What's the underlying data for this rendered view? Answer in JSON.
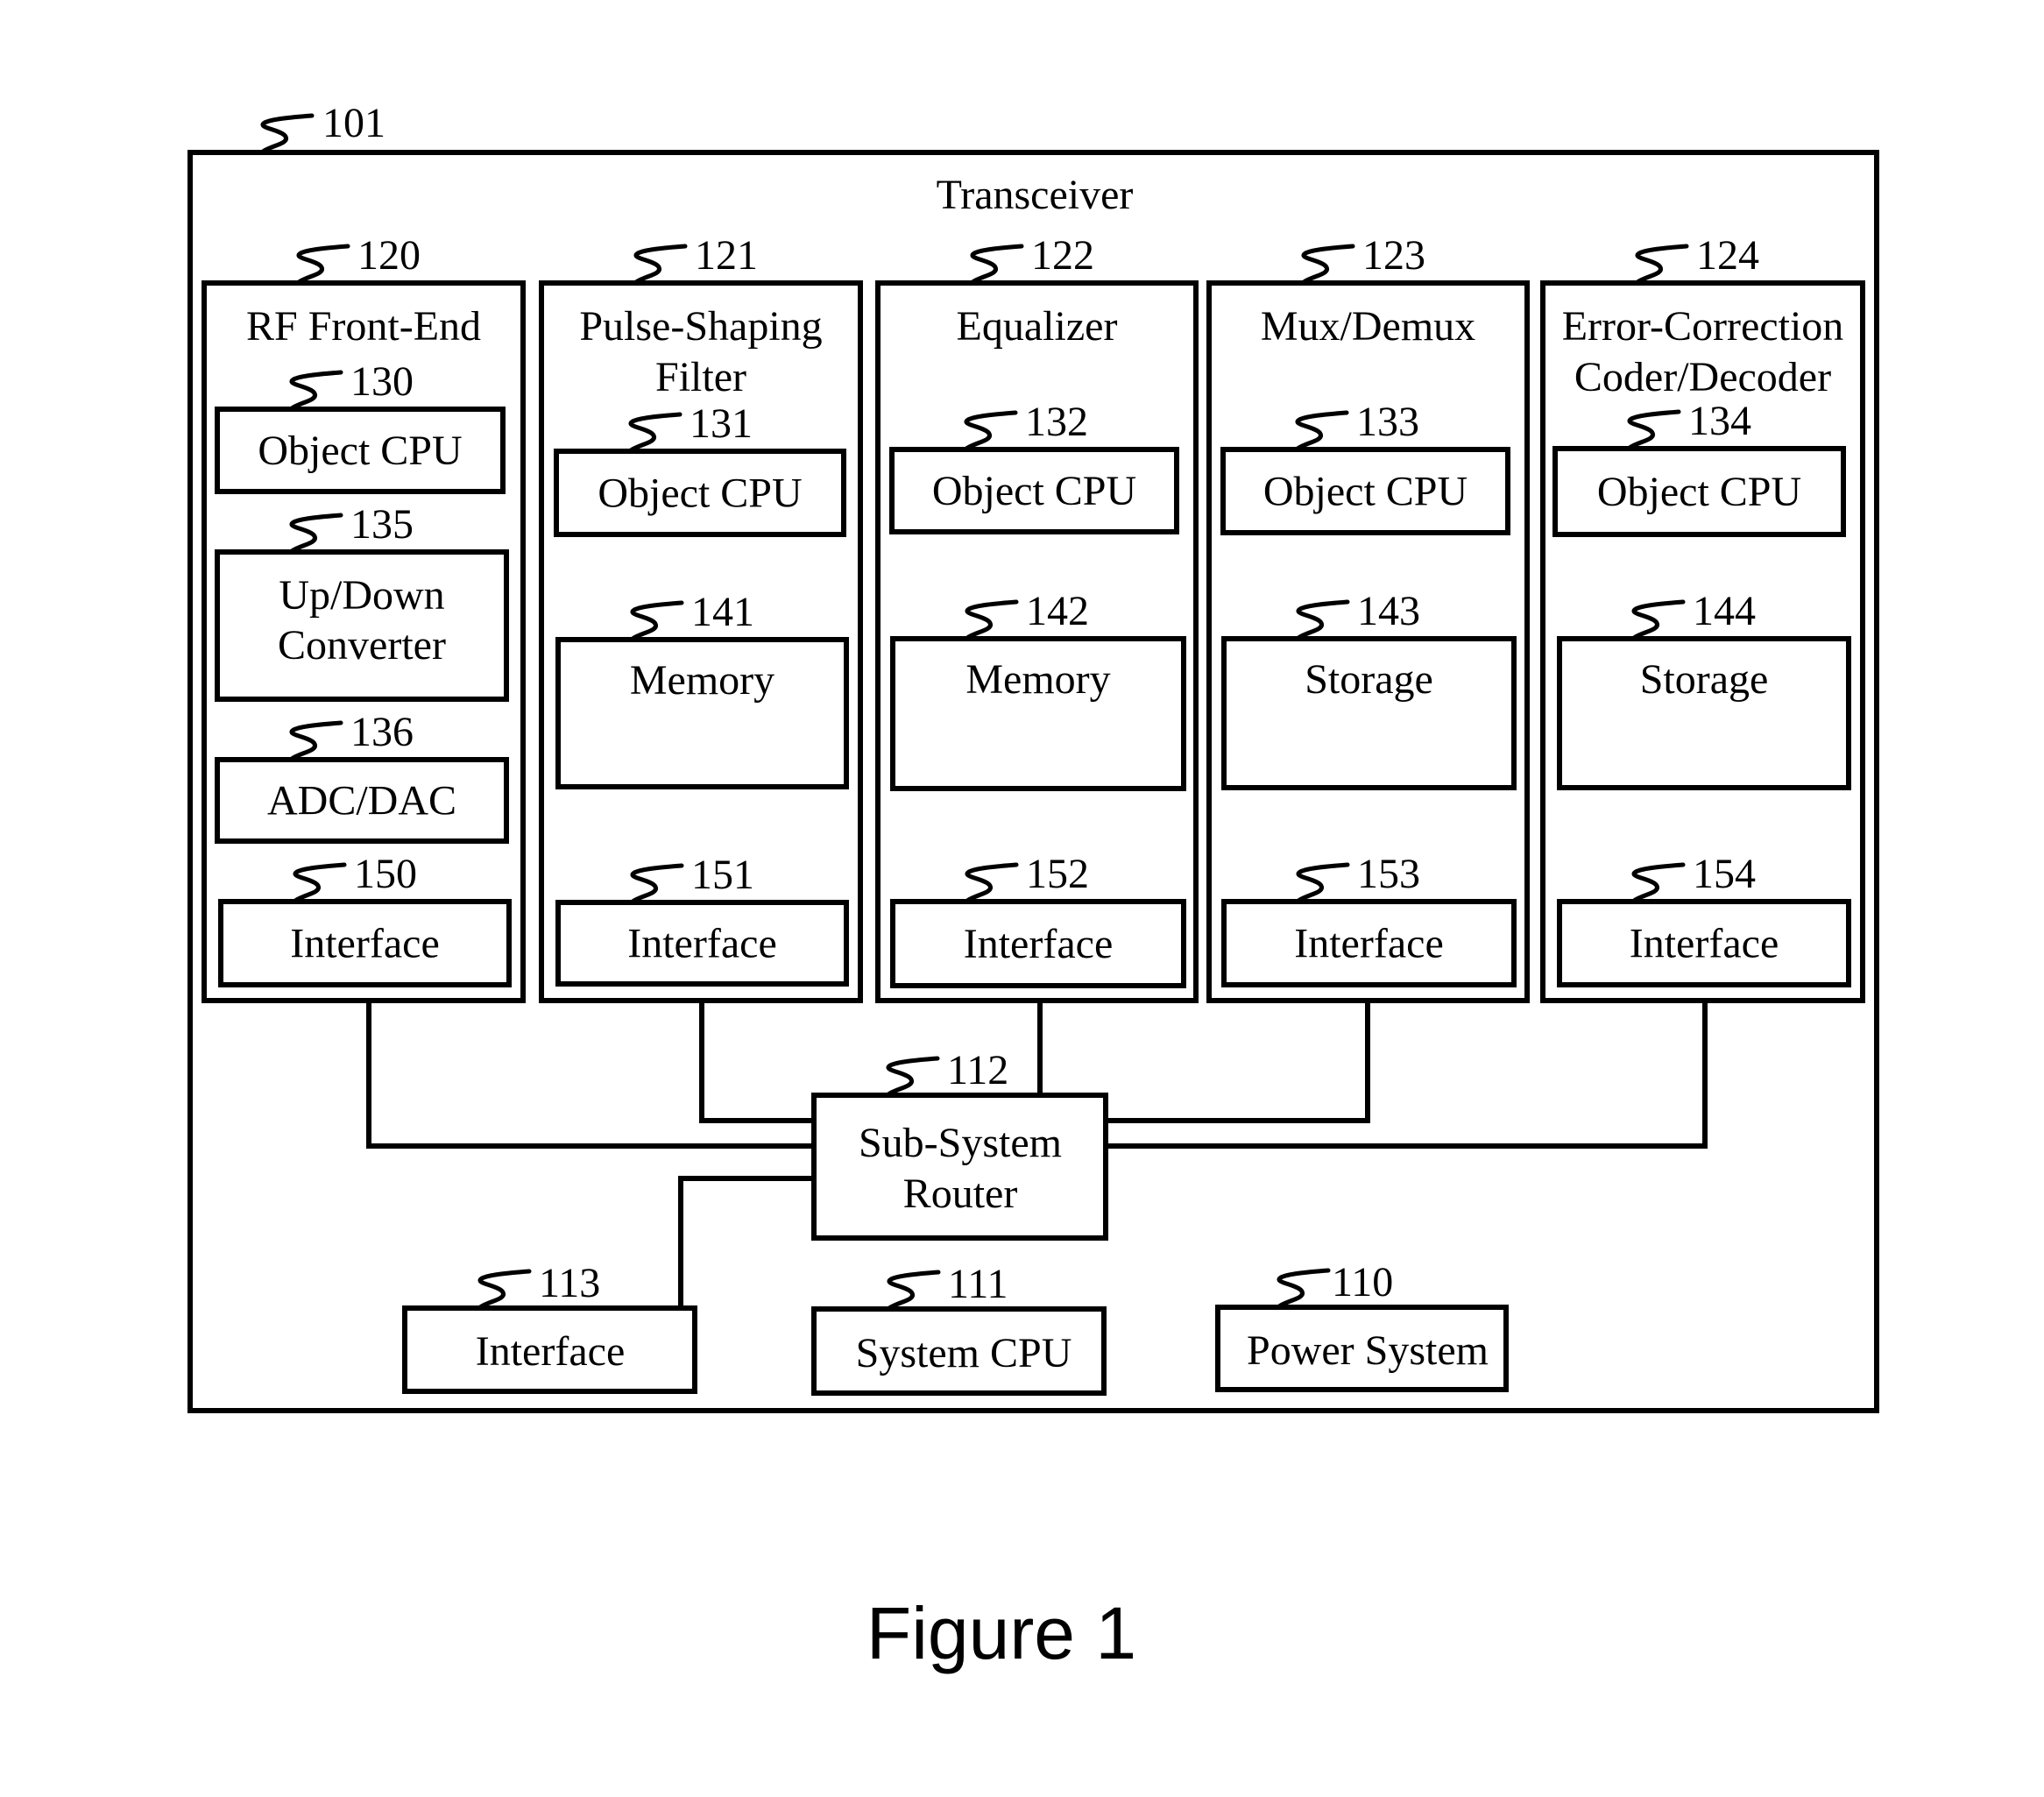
{
  "figure": {
    "caption": "Figure 1",
    "transceiver": {
      "ref": "101",
      "title": "Transceiver"
    },
    "subsystems": [
      {
        "ref": "120",
        "title_lines": [
          "RF Front-End"
        ],
        "components": [
          {
            "ref": "130",
            "lines": [
              "Object CPU"
            ]
          },
          {
            "ref": "135",
            "lines": [
              "Up/Down",
              "Converter"
            ]
          },
          {
            "ref": "136",
            "lines": [
              "ADC/DAC"
            ]
          },
          {
            "ref": "150",
            "lines": [
              "Interface"
            ]
          }
        ]
      },
      {
        "ref": "121",
        "title_lines": [
          "Pulse-Shaping",
          "Filter"
        ],
        "components": [
          {
            "ref": "131",
            "lines": [
              "Object CPU"
            ]
          },
          {
            "ref": "141",
            "lines": [
              "Memory"
            ]
          },
          {
            "ref": "151",
            "lines": [
              "Interface"
            ]
          }
        ]
      },
      {
        "ref": "122",
        "title_lines": [
          "Equalizer"
        ],
        "components": [
          {
            "ref": "132",
            "lines": [
              "Object CPU"
            ]
          },
          {
            "ref": "142",
            "lines": [
              "Memory"
            ]
          },
          {
            "ref": "152",
            "lines": [
              "Interface"
            ]
          }
        ]
      },
      {
        "ref": "123",
        "title_lines": [
          "Mux/Demux"
        ],
        "components": [
          {
            "ref": "133",
            "lines": [
              "Object CPU"
            ]
          },
          {
            "ref": "143",
            "lines": [
              "Storage"
            ]
          },
          {
            "ref": "153",
            "lines": [
              "Interface"
            ]
          }
        ]
      },
      {
        "ref": "124",
        "title_lines": [
          "Error-Correction",
          "Coder/Decoder"
        ],
        "components": [
          {
            "ref": "134",
            "lines": [
              "Object CPU"
            ]
          },
          {
            "ref": "144",
            "lines": [
              "Storage"
            ]
          },
          {
            "ref": "154",
            "lines": [
              "Interface"
            ]
          }
        ]
      }
    ],
    "router": {
      "ref": "112",
      "lines": [
        "Sub-System",
        "Router"
      ]
    },
    "interface": {
      "ref": "113",
      "lines": [
        "Interface"
      ]
    },
    "system_cpu": {
      "ref": "111",
      "lines": [
        "System CPU"
      ]
    },
    "power_system": {
      "ref": "110",
      "lines": [
        "Power System"
      ]
    }
  }
}
